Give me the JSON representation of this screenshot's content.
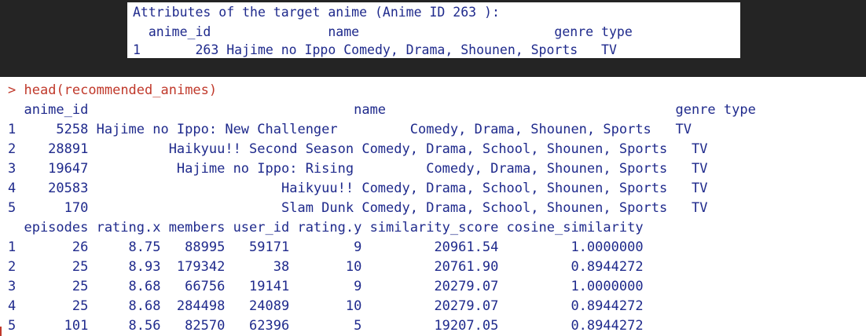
{
  "target": {
    "title": "Attributes of the target anime (Anime ID 263 ):",
    "header": "  anime_id               name                         genre type",
    "row": "1       263 Hajime no Ippo Comedy, Drama, Shounen, Sports   TV"
  },
  "console": {
    "prompt": ">",
    "command": "head(recommended_animes)",
    "table1": {
      "header": "  anime_id                                 name                                    genre type",
      "rows": [
        "1     5258 Hajime no Ippo: New Challenger         Comedy, Drama, Shounen, Sports   TV",
        "2    28891          Haikyuu!! Second Season Comedy, Drama, School, Shounen, Sports   TV",
        "3    19647           Hajime no Ippo: Rising         Comedy, Drama, Shounen, Sports   TV",
        "4    20583                        Haikyuu!! Comedy, Drama, School, Shounen, Sports   TV",
        "5      170                        Slam Dunk Comedy, Drama, School, Shounen, Sports   TV"
      ]
    },
    "table2": {
      "header": "  episodes rating.x members user_id rating.y similarity_score cosine_similarity",
      "rows": [
        "1       26     8.75   88995   59171        9         20961.54         1.0000000",
        "2       25     8.93  179342      38       10         20761.90         0.8944272",
        "3       25     8.68   66756   19141        9         20279.07         1.0000000",
        "4       25     8.68  284498   24089       10         20279.07         0.8944272",
        "5      101     8.56   82570   62396        5         19207.05         0.8944272"
      ]
    }
  }
}
